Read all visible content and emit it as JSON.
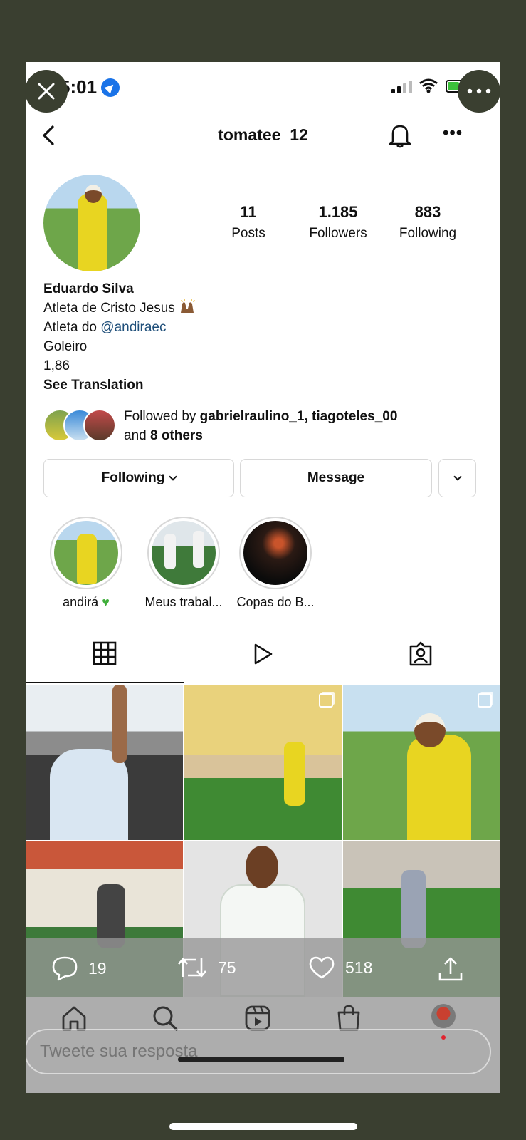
{
  "status_bar": {
    "time": "5:01"
  },
  "header": {
    "username": "tomatee_12"
  },
  "stats": [
    {
      "num": "11",
      "label": "Posts"
    },
    {
      "num": "1.185",
      "label": "Followers"
    },
    {
      "num": "883",
      "label": "Following"
    }
  ],
  "bio": {
    "name": "Eduardo Silva",
    "line1": "Atleta de Cristo Jesus",
    "line2_prefix": "Atleta do ",
    "line2_link": "@andiraec",
    "line3": "Goleiro",
    "line4": "1,86",
    "translate": "See Translation"
  },
  "followed_by": {
    "prefix": "Followed by ",
    "users": "gabrielraulino_1, tiagoteles_00",
    "and": "and ",
    "others": "8 others"
  },
  "actions": {
    "following": "Following",
    "message": "Message"
  },
  "highlights": [
    {
      "label": "andirá"
    },
    {
      "label": "Meus trabal..."
    },
    {
      "label": "Copas do B..."
    }
  ],
  "tweet": {
    "replies": "19",
    "retweets": "75",
    "likes": "518",
    "placeholder": "Tweete sua resposta"
  },
  "colors": {
    "overlay_bg": "#3a3f30",
    "link": "#1f4f7a",
    "heart": "#3fae3a"
  }
}
